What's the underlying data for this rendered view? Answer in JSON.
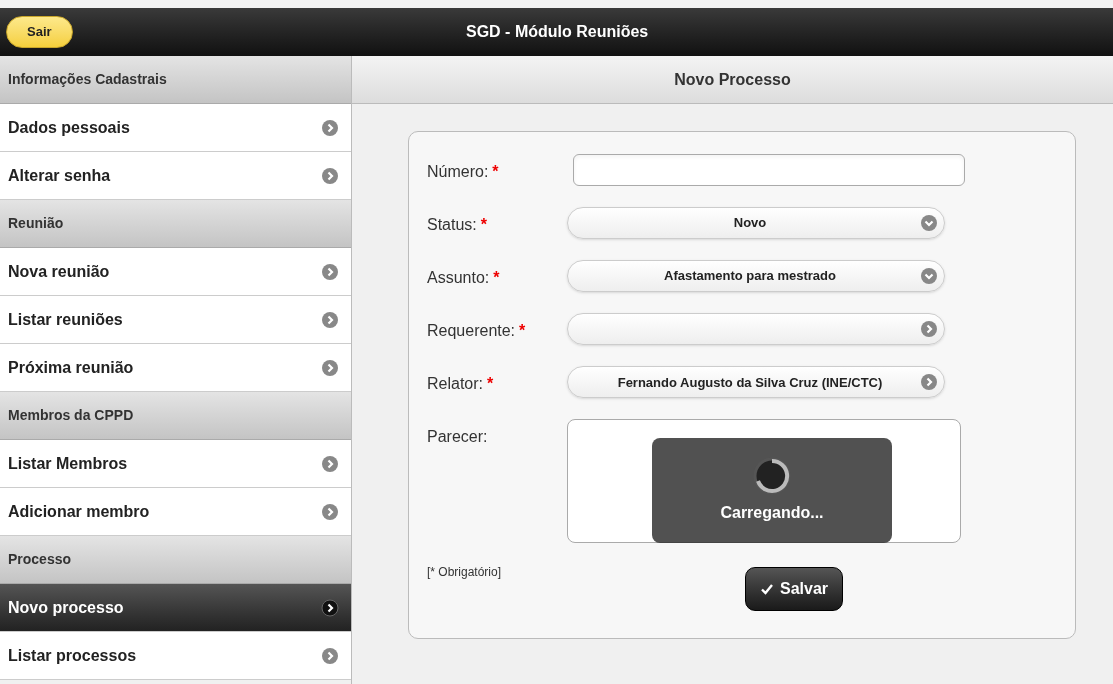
{
  "header": {
    "back_button": "Sair",
    "title": "SGD - Módulo Reuniões"
  },
  "sidebar": [
    {
      "kind": "header",
      "label": "Informações Cadastrais"
    },
    {
      "kind": "item",
      "label": "Dados pessoais",
      "selected": false
    },
    {
      "kind": "item",
      "label": "Alterar senha",
      "selected": false
    },
    {
      "kind": "header",
      "label": "Reunião"
    },
    {
      "kind": "item",
      "label": "Nova reunião",
      "selected": false
    },
    {
      "kind": "item",
      "label": "Listar reuniões",
      "selected": false
    },
    {
      "kind": "item",
      "label": "Próxima reunião",
      "selected": false
    },
    {
      "kind": "header",
      "label": "Membros da CPPD"
    },
    {
      "kind": "item",
      "label": "Listar Membros",
      "selected": false
    },
    {
      "kind": "item",
      "label": "Adicionar membro",
      "selected": false
    },
    {
      "kind": "header",
      "label": "Processo"
    },
    {
      "kind": "item",
      "label": "Novo processo",
      "selected": true
    },
    {
      "kind": "item",
      "label": "Listar processos",
      "selected": false
    }
  ],
  "main": {
    "title": "Novo Processo",
    "fields": [
      {
        "kind": "text",
        "label": "Número:",
        "required": true
      },
      {
        "kind": "select",
        "label": "Status:",
        "required": true,
        "value": "Novo"
      },
      {
        "kind": "select",
        "label": "Assunto:",
        "required": true,
        "value": "Afastamento para mestrado"
      },
      {
        "kind": "link",
        "label": "Requerente:",
        "required": true
      },
      {
        "kind": "link",
        "label": "Relator:",
        "required": true,
        "value": "Fernando Augusto da Silva Cruz (INE/CTC)"
      },
      {
        "kind": "textarea",
        "label": "Parecer:",
        "required": false
      }
    ],
    "required_mark": "*",
    "required_note": "[* Obrigatório]",
    "save_button": "Salvar"
  },
  "loading": {
    "text": "Carregando..."
  }
}
